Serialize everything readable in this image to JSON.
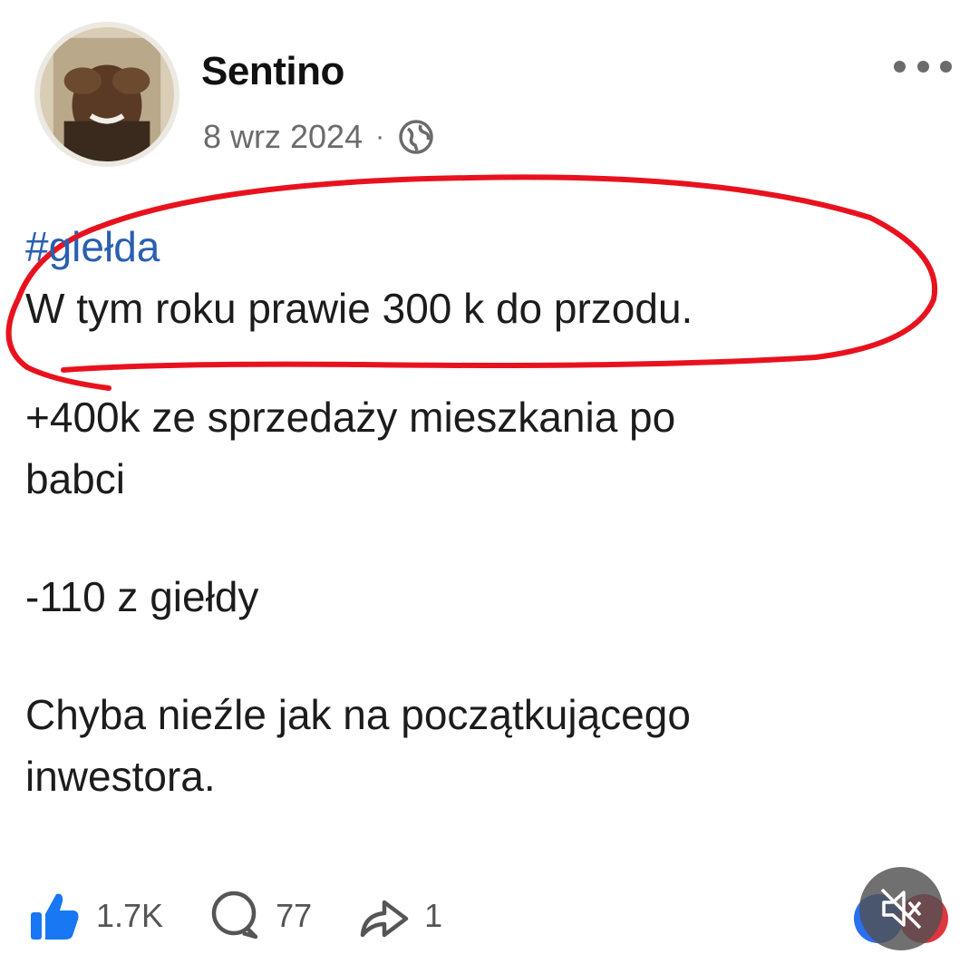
{
  "post": {
    "author": "Sentino",
    "date": "8 wrz 2024",
    "separator": "·",
    "privacy_icon": "globe-icon",
    "hashtag": "#giełda",
    "highlighted_line": "W tym roku prawie 300 k do przodu.",
    "para1_line1": "+400k ze sprzedaży mieszkania po",
    "para1_line2": "babci",
    "para2": "-110 z giełdy",
    "para3_line1": "Chyba nieźle jak na początkującego",
    "para3_line2": "inwestora."
  },
  "stats": {
    "likes": "1.7K",
    "comments": "77",
    "shares": "1"
  },
  "colors": {
    "hashtag": "#2a5fb0",
    "like_blue": "#1877f2",
    "highlight_red": "#e8121e"
  }
}
